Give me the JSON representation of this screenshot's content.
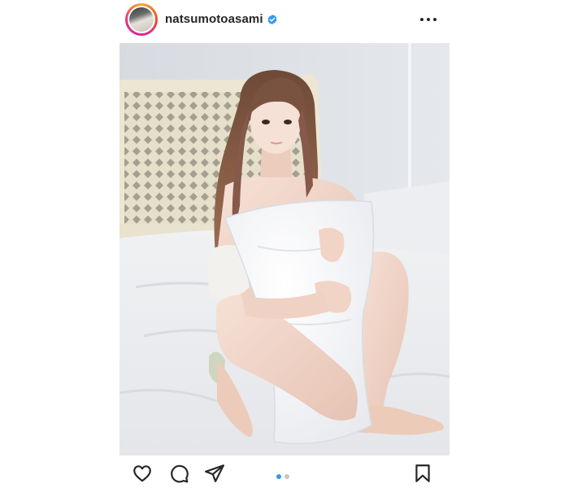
{
  "post": {
    "username": "natsumotoasami",
    "verified": true,
    "carousel": {
      "total": 2,
      "active": 1
    }
  },
  "icons": {
    "more": "more-horizontal-icon",
    "verified": "verified-badge-icon",
    "like": "heart-icon",
    "comment": "comment-icon",
    "share": "paper-plane-icon",
    "save": "bookmark-icon"
  },
  "colors": {
    "text": "#262626",
    "verified": "#3897f0",
    "carousel_active": "#3897f0",
    "carousel_inactive": "#c7c7c7",
    "avatar_ring": [
      "#f9a825",
      "#ef4b2c",
      "#d6249f"
    ]
  }
}
